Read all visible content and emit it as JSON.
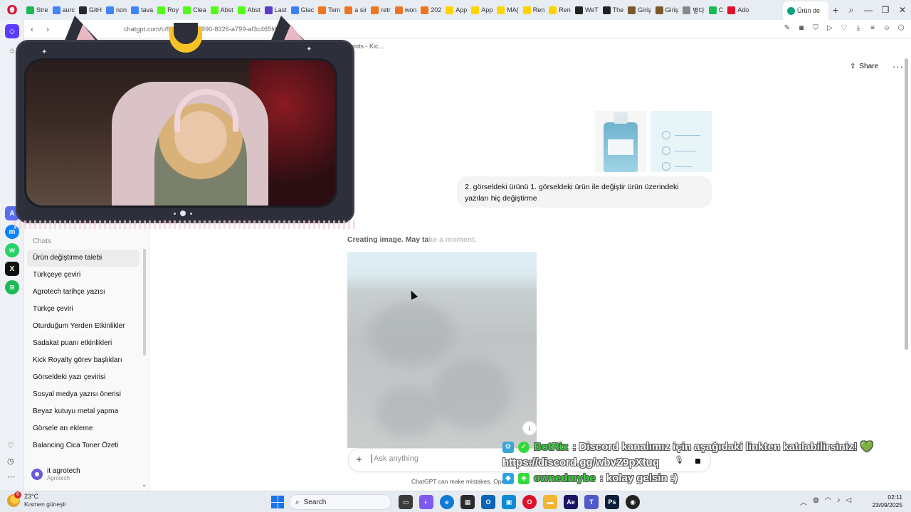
{
  "browser": {
    "tabs": [
      {
        "label": "Stre",
        "color": "#1db954"
      },
      {
        "label": "aurc",
        "color": "#4285f4"
      },
      {
        "label": "GitH",
        "color": "#24292e"
      },
      {
        "label": "non",
        "color": "#4285f4"
      },
      {
        "label": "tava",
        "color": "#4285f4"
      },
      {
        "label": "Roy",
        "color": "#53fc18"
      },
      {
        "label": "Clea",
        "color": "#53fc18"
      },
      {
        "label": "Abst",
        "color": "#53fc18"
      },
      {
        "label": "Abst",
        "color": "#53fc18"
      },
      {
        "label": "Last",
        "color": "#5b3cc4"
      },
      {
        "label": "Glac",
        "color": "#3b82f6"
      },
      {
        "label": "Tem",
        "color": "#ee7623"
      },
      {
        "label": "a sir",
        "color": "#ee7623"
      },
      {
        "label": "retr",
        "color": "#ee7623"
      },
      {
        "label": "won",
        "color": "#ee7623"
      },
      {
        "label": "202",
        "color": "#ee7623"
      },
      {
        "label": "App",
        "color": "#ffd400"
      },
      {
        "label": "App",
        "color": "#ffd400"
      },
      {
        "label": "MA(",
        "color": "#ffd400"
      },
      {
        "label": "Ren",
        "color": "#ffd400"
      },
      {
        "label": "Ren",
        "color": "#ffd400"
      },
      {
        "label": "WeT",
        "color": "#222222"
      },
      {
        "label": "The",
        "color": "#222222"
      },
      {
        "label": "Giriş",
        "color": "#7a5a2a"
      },
      {
        "label": "Giriş",
        "color": "#7a5a2a"
      },
      {
        "label": "별다",
        "color": "#888888"
      },
      {
        "label": "C",
        "color": "#1db954"
      },
      {
        "label": "Ado",
        "color": "#e0102a"
      }
    ],
    "active_tab": "Ürün de",
    "url": "chatgpt.com/c/68d1d728-5990-8326-a799-af3c465fda48",
    "url_prefix": "ant.com/c/68d1d728-59",
    "url_suffix": "83260799-af3c465fda48",
    "bookmark_text": "Points - Kic..."
  },
  "sidebar": {
    "chats_header": "Chats",
    "items": [
      "Ürün değiştirme talebi",
      "Türkçeye çeviri",
      "Agrotech tarihçe yazısı",
      "Türkçe çeviri",
      "Oturduğum Yerden Etkinlikler",
      "Sadakat puanı etkinlikleri",
      "Kick Royalty görev başlıkları",
      "Görseldeki yazı çevirisi",
      "Sosyal medya yazısı önerisi",
      "Beyaz kutuyu metal yapma",
      "Görsele arı ekleme",
      "Balancing Cica Toner Özeti"
    ],
    "user": {
      "name": "it agrotech",
      "plan": "Agrotech"
    }
  },
  "header": {
    "share_label": "Share",
    "more_label": "···"
  },
  "conversation": {
    "user_message": "2. görseldeki ürünü 1. görseldeki ürün ile değiştir ürün üzerindeki yazıları hiç değiştirme",
    "status_text": "Creating image. May ta",
    "status_text_faded": "ke a moment."
  },
  "composer": {
    "placeholder": "Ask anything",
    "plus_label": "+",
    "disclaimer": "ChatGPT can make mistakes. OpenAI"
  },
  "overlay_chat": [
    {
      "user": "BotRix",
      "message": ": Discord kanalımız için aşağıdaki linkten katılabilirsiniz! 💚",
      "link": "https://discord.gg/wbvZ9pXtuq"
    },
    {
      "user": "ownedmybe",
      "message": ": kolay gelsin :)"
    }
  ],
  "taskbar": {
    "weather_temp": "23°C",
    "weather_desc": "Kısmen güneşli",
    "weather_badge": "6",
    "search_label": "Search",
    "time": "02:11",
    "date": "23/09/2025"
  },
  "colors": {
    "accent_selected": "#ececec",
    "bot_name": "#35d93a"
  }
}
